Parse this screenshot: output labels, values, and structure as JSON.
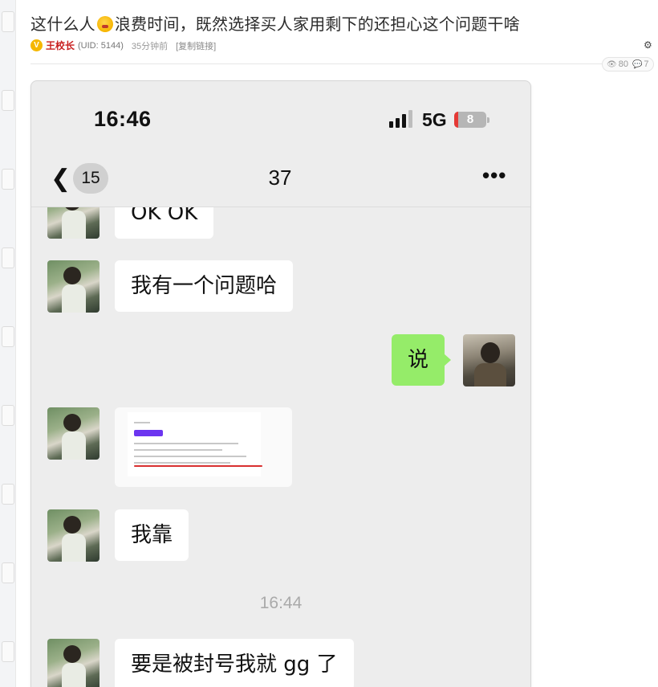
{
  "post": {
    "title_part1": "这什么人",
    "title_emoji": "face-with-hand-over-mouth",
    "title_part2": "浪费时间，既然选择买人家用剩下的还担心这个问题干啥",
    "badge": "V",
    "author": "王校长",
    "uid": "(UID: 5144)",
    "time": "35分钟前",
    "copy_link": "[复制链接]",
    "views": "80",
    "comments": "7"
  },
  "phone": {
    "clock": "16:46",
    "network": "5G",
    "battery": "8",
    "back_count": "15",
    "chat_title": "37",
    "more": "•••"
  },
  "messages": [
    {
      "side": "left",
      "text": "OK OK"
    },
    {
      "side": "left",
      "text": "我有一个问题哈"
    },
    {
      "side": "right",
      "text": "说"
    },
    {
      "side": "left",
      "type": "image"
    },
    {
      "side": "left",
      "text": "我靠"
    },
    {
      "type": "timestamp",
      "text": "16:44"
    },
    {
      "side": "left",
      "text": "要是被封号我就 gg 了"
    }
  ],
  "colors": {
    "accent_red": "#c81e1e",
    "bubble_green": "#95ec69",
    "chat_bg": "#ededed"
  }
}
